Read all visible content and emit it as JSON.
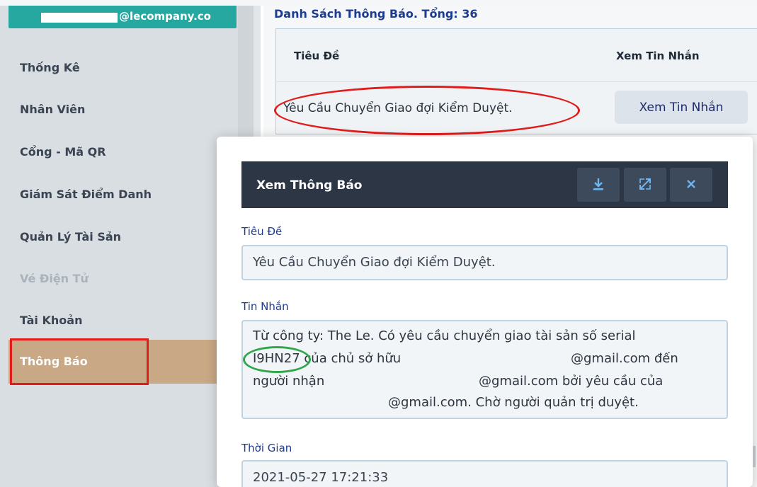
{
  "sidebar": {
    "user_email_suffix": "@lecompany.co",
    "items": [
      {
        "label": "Thống Kê"
      },
      {
        "label": "Nhân Viên"
      },
      {
        "label": "Cổng - Mã QR"
      },
      {
        "label": "Giám Sát Điểm Danh"
      },
      {
        "label": "Quản Lý Tài Sản"
      },
      {
        "label": "Vé Điện Tử"
      },
      {
        "label": "Tài Khoản"
      },
      {
        "label": "Thông Báo"
      }
    ]
  },
  "list": {
    "title": "Danh Sách Thông Báo. Tổng: 36",
    "columns": [
      "Tiêu Đề",
      "Xem Tin Nhắn"
    ],
    "rows": [
      {
        "title": "Yêu Cầu Chuyển Giao đợi Kiểm Duyệt.",
        "action": "Xem Tin Nhắn"
      }
    ]
  },
  "modal": {
    "title": "Xem Thông Báo",
    "title_label": "Tiêu Đề",
    "title_value": "Yêu Cầu Chuyển Giao đợi Kiểm Duyệt.",
    "message_label": "Tin Nhắn",
    "message_lines": [
      "Từ công ty: The Le. Có yêu cầu chuyển giao tài sản số serial",
      "I9HN27 của chủ sở hữu",
      "@gmail.com đến",
      "người nhận",
      "@gmail.com bởi yêu cầu của",
      "@gmail.com. Chờ người quản trị duyệt."
    ],
    "time_label": "Thời Gian",
    "time_value": "2021-05-27 17:21:33",
    "icons": [
      "download-icon",
      "expand-icon",
      "close-icon"
    ]
  },
  "colors": {
    "sidebar_bg": "#d9dee2",
    "email_bar": "#26a79f",
    "active_item": "#c9a985",
    "modal_header": "#2c3645",
    "label_blue": "#1d3c8f",
    "annotation_red": "#e21b1b",
    "annotation_green": "#2ea84a"
  }
}
